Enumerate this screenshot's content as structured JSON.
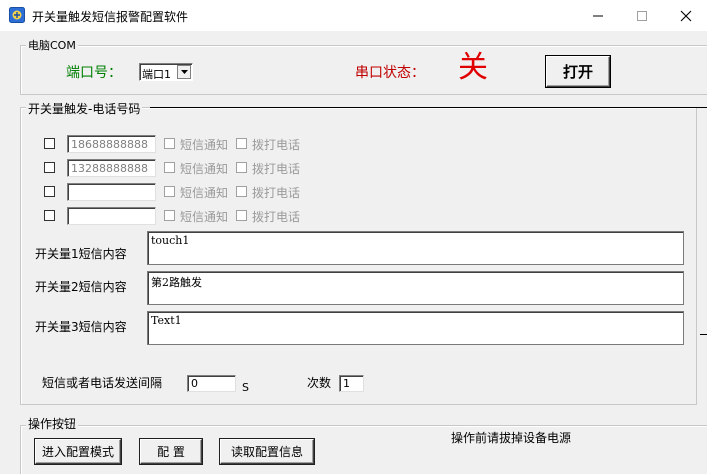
{
  "window": {
    "title": "开关量触发短信报警配置软件",
    "minimize_glyph": "—",
    "maximize_glyph": "☐",
    "close_glyph": "✕"
  },
  "com_group": {
    "legend": "电脑COM",
    "port_label": "端口号：",
    "port_value": "端口1",
    "status_label": "串口状态：",
    "status_value": "关",
    "open_button": "打开",
    "colors": {
      "port_label": "#008000",
      "status_label": "#c00000",
      "status_value": "#e00000"
    }
  },
  "trigger_group": {
    "legend": "开关量触发-电话号码",
    "phone_rows": [
      {
        "checked": false,
        "number": "18688888888",
        "sms_label": "短信通知",
        "call_label": "拨打电话"
      },
      {
        "checked": false,
        "number": "13288888888",
        "sms_label": "短信通知",
        "call_label": "拨打电话"
      },
      {
        "checked": false,
        "number": "",
        "sms_label": "短信通知",
        "call_label": "拨打电话"
      },
      {
        "checked": false,
        "number": "",
        "sms_label": "短信通知",
        "call_label": "拨打电话"
      }
    ],
    "sms_rows": [
      {
        "label": "开关量1短信内容",
        "content": "touch1"
      },
      {
        "label": "开关量2短信内容",
        "content": "第2路触发"
      },
      {
        "label": "开关量3短信内容",
        "content": "Text1"
      }
    ],
    "interval_label": "短信或者电话发送间隔",
    "interval_value": "0",
    "interval_unit": "S",
    "count_label": "次数",
    "count_value": "1"
  },
  "ops_group": {
    "legend": "操作按钮",
    "buttons": [
      "进入配置模式",
      "配 置",
      "读取配置信息"
    ],
    "notice": "操作前请拔掉设备电源"
  }
}
